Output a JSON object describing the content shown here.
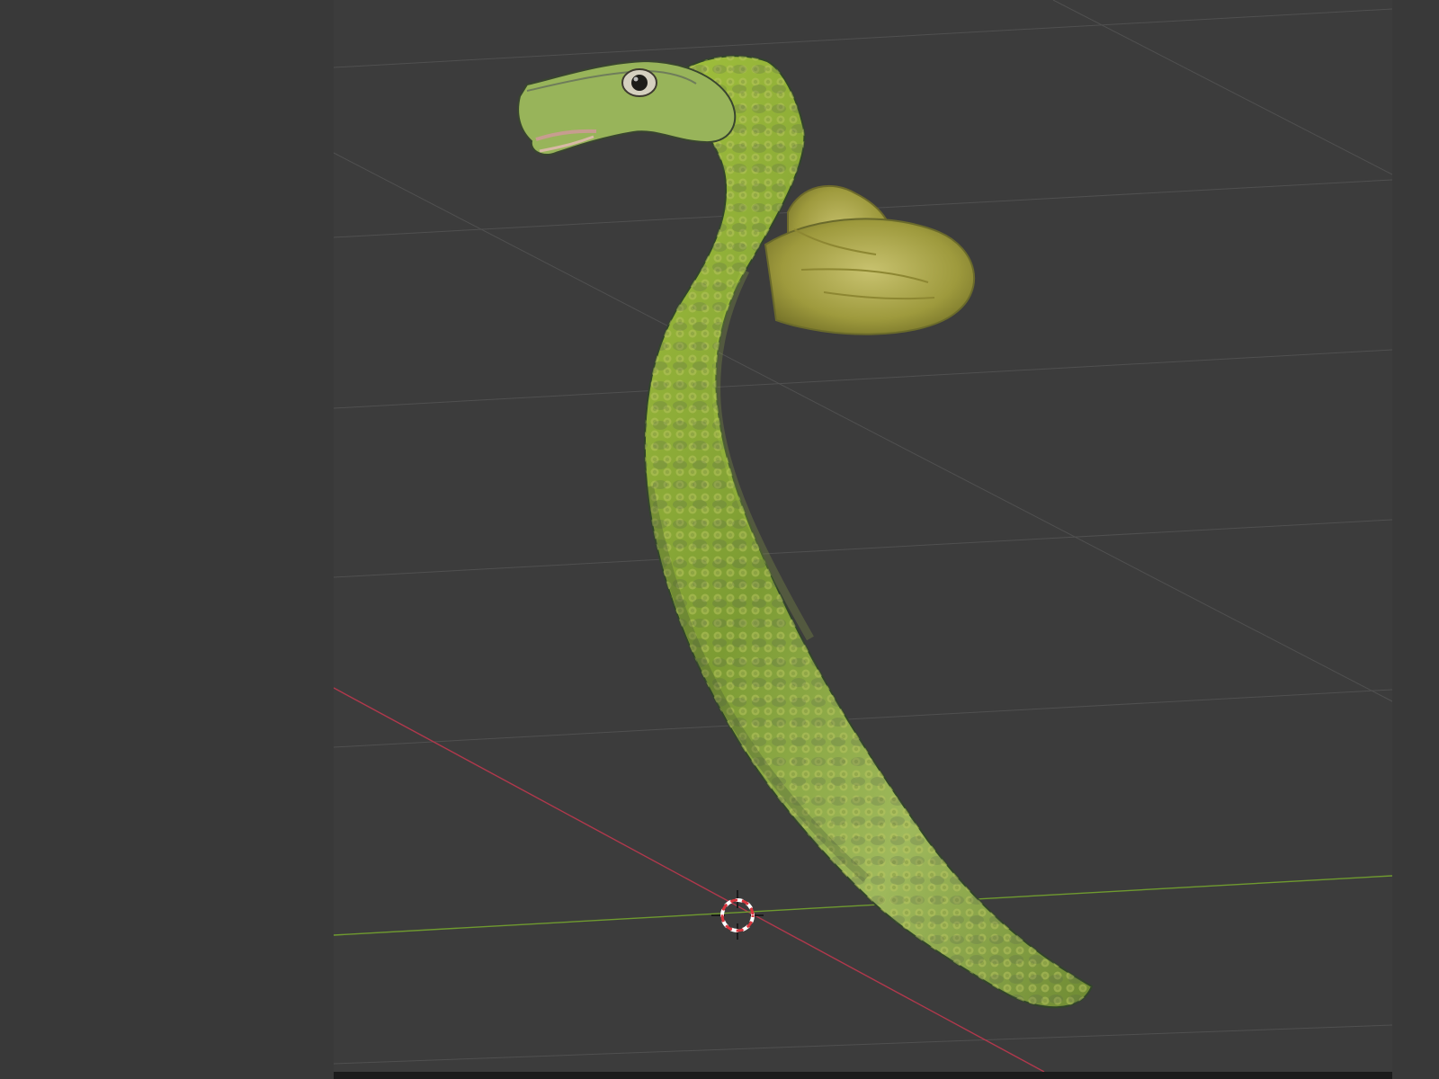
{
  "app": {
    "panels": {
      "left_panel_color": "#393939",
      "viewport_color": "#3c3c3c",
      "right_panel_color": "#393939",
      "bottom_bar_color": "#1c1c1c"
    },
    "viewport": {
      "grid_color": "#505050",
      "x_axis_color": "#b0384c",
      "y_axis_color": "#6f9a2f",
      "cursor_color": "#ffffff",
      "cursor_ring_color": "#d9363e",
      "object_name": "",
      "object_colors": {
        "base_green": "#8aaa2d",
        "highlight_green": "#a8cc3c",
        "dark_scale": "#4a5a42",
        "fin": "#b8b255",
        "mouth": "#d8b9a5",
        "eye": "#1d1c19"
      },
      "icons": {
        "cursor": "3d-cursor-icon"
      }
    }
  }
}
